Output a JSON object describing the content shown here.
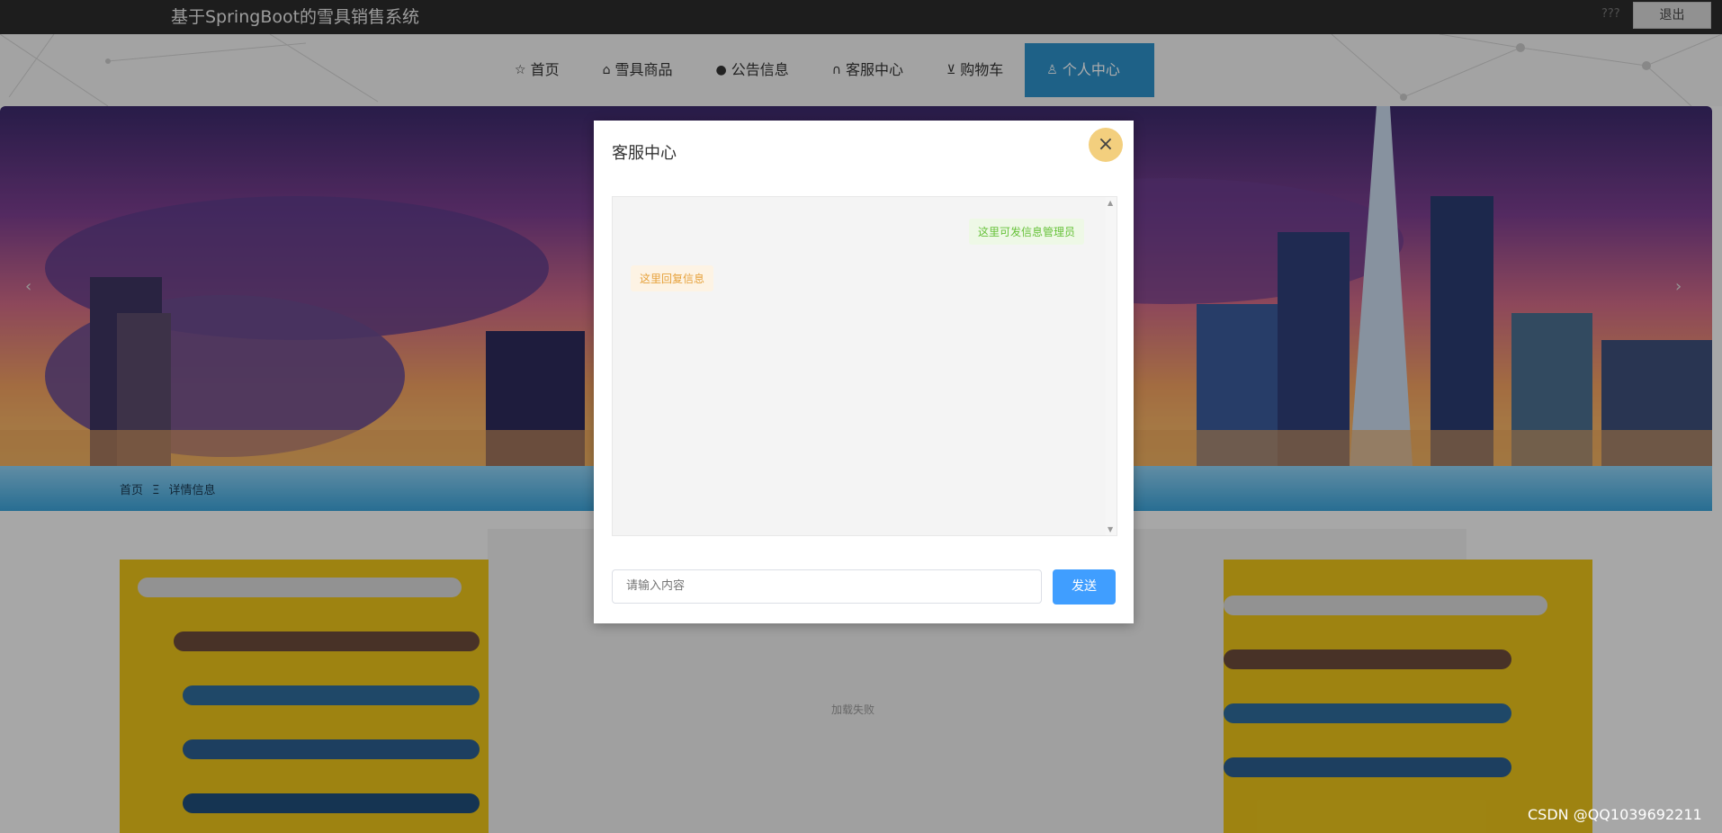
{
  "topbar": {
    "title": "基于SpringBoot的雪具销售系统",
    "user_label": "???",
    "logout_label": "退出"
  },
  "nav": {
    "items": [
      {
        "icon": "star-icon",
        "label": "首页"
      },
      {
        "icon": "bag-icon",
        "label": "雪具商品"
      },
      {
        "icon": "info-icon",
        "label": "公告信息"
      },
      {
        "icon": "headset-icon",
        "label": "客服中心"
      },
      {
        "icon": "cart-icon",
        "label": "购物车"
      },
      {
        "icon": "user-icon",
        "label": "个人中心",
        "active": true
      }
    ]
  },
  "crumb": {
    "home": "首页",
    "sep": "Ξ",
    "current": "详情信息"
  },
  "content": {
    "muted_text": "加载失败"
  },
  "modal": {
    "title": "客服中心",
    "close_icon": "close-icon",
    "messages": [
      {
        "side": "right",
        "text": "这里可发信息管理员"
      },
      {
        "side": "left",
        "text": "这里回复信息"
      }
    ],
    "input_placeholder": "请输入内容",
    "send_label": "发送"
  },
  "watermark": "CSDN @QQ1039692211",
  "colors": {
    "accent": "#409eff",
    "nav_active": "#2d8fc8",
    "msg_right": "#67c23a",
    "msg_left": "#e6a23c"
  }
}
